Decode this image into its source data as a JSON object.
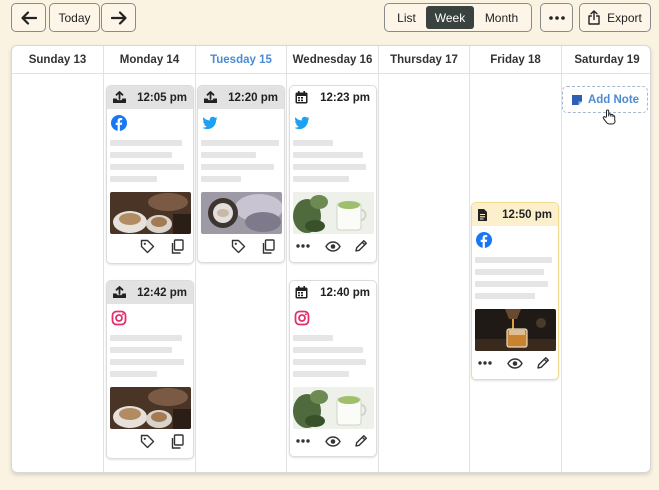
{
  "toolbar": {
    "back_icon": "arrow-left-icon",
    "today_label": "Today",
    "forward_icon": "arrow-right-icon",
    "views": [
      {
        "label": "List",
        "active": false
      },
      {
        "label": "Week",
        "active": true
      },
      {
        "label": "Month",
        "active": false
      }
    ],
    "more_icon": "ellipsis-icon",
    "export_label": "Export",
    "export_icon": "share-icon"
  },
  "colors": {
    "background": "#fbf3e2",
    "today_header": "#4a8bd4",
    "active_view": "#3a423f",
    "facebook": "#1877f2",
    "twitter": "#1da1f2",
    "instagram": "#e1306c",
    "note_header": "#fcf0cc"
  },
  "days": [
    {
      "label": "Sunday 13",
      "today": false
    },
    {
      "label": "Monday 14",
      "today": false
    },
    {
      "label": "Tuesday 15",
      "today": true
    },
    {
      "label": "Wednesday 16",
      "today": false
    },
    {
      "label": "Thursday 17",
      "today": false
    },
    {
      "label": "Friday 18",
      "today": false
    },
    {
      "label": "Saturday 19",
      "today": false
    }
  ],
  "posts": [
    {
      "day": "Monday 14",
      "time": "12:05 pm",
      "status_icon": "upload-tray-icon",
      "network": "facebook-icon",
      "photo": "coffee-cups-photo",
      "actions": [
        "tag-icon",
        "copy-icon"
      ]
    },
    {
      "day": "Monday 14",
      "time": "12:42 pm",
      "status_icon": "upload-tray-icon",
      "network": "instagram-icon",
      "photo": "coffee-cups-photo",
      "actions": [
        "tag-icon",
        "copy-icon"
      ]
    },
    {
      "day": "Tuesday 15",
      "time": "12:20 pm",
      "status_icon": "upload-tray-icon",
      "network": "twitter-icon",
      "photo": "lavender-cup-photo",
      "actions": [
        "tag-icon",
        "copy-icon"
      ]
    },
    {
      "day": "Wednesday 16",
      "time": "12:23 pm",
      "status_icon": "calendar-icon",
      "network": "twitter-icon",
      "photo": "matcha-latte-photo",
      "actions": [
        "ellipsis-icon",
        "eye-icon",
        "pencil-icon"
      ]
    },
    {
      "day": "Wednesday 16",
      "time": "12:40 pm",
      "status_icon": "calendar-icon",
      "network": "instagram-icon",
      "photo": "matcha-latte-photo",
      "actions": [
        "ellipsis-icon",
        "eye-icon",
        "pencil-icon"
      ]
    },
    {
      "day": "Friday 18",
      "time": "12:50 pm",
      "status_icon": "document-icon",
      "network": "facebook-icon",
      "photo": "whiskey-pour-photo",
      "actions": [
        "ellipsis-icon",
        "eye-icon",
        "pencil-icon"
      ]
    }
  ],
  "add_note": {
    "label": "Add Note",
    "icon": "note-icon",
    "cursor_icon": "hand-pointer-icon"
  }
}
